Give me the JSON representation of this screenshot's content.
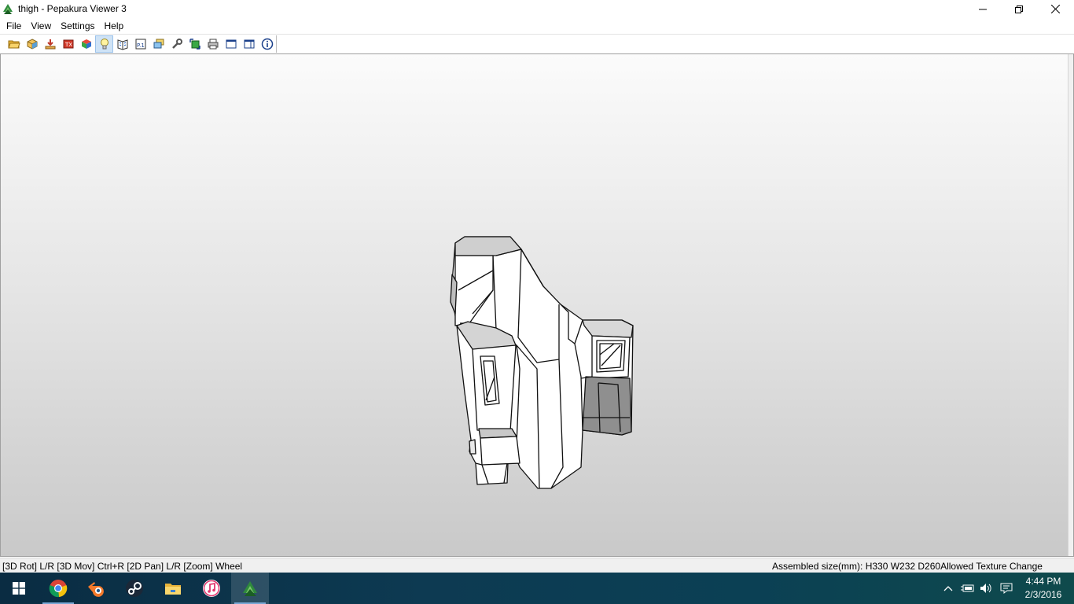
{
  "window": {
    "title": "thigh - Pepakura Viewer 3",
    "controls": [
      "minimize",
      "restore",
      "close"
    ]
  },
  "menu": {
    "items": [
      "File",
      "View",
      "Settings",
      "Help"
    ]
  },
  "toolbar": {
    "icons": [
      "open-folder-icon",
      "3d-model-icon",
      "unfold-icon",
      "texture-icon",
      "color-cube-icon",
      "light-bulb-icon",
      "book-icon",
      "page-number-icon",
      "layers-icon",
      "wrench-icon",
      "export-icon",
      "print-icon",
      "single-pane-icon",
      "split-pane-icon",
      "info-icon"
    ],
    "active_icon": "light-bulb-icon"
  },
  "status": {
    "left": "[3D Rot] L/R [3D Mov] Ctrl+R [2D Pan] L/R [Zoom] Wheel",
    "right": "Assembled size(mm): H330 W232 D260Allowed Texture Change"
  },
  "taskbar": {
    "apps": [
      "windows-start-icon",
      "chrome-icon",
      "blender-icon",
      "steam-icon",
      "file-explorer-icon",
      "itunes-icon",
      "pepakura-icon"
    ],
    "active_app": "pepakura-icon",
    "tray_icons": [
      "chevron-up-icon",
      "battery-icon",
      "volume-icon",
      "notification-icon"
    ],
    "time": "4:44 PM",
    "date": "2/3/2016"
  },
  "colors": {
    "accent_active": "#cfe3f6",
    "taskbar": "#0d3a52"
  }
}
